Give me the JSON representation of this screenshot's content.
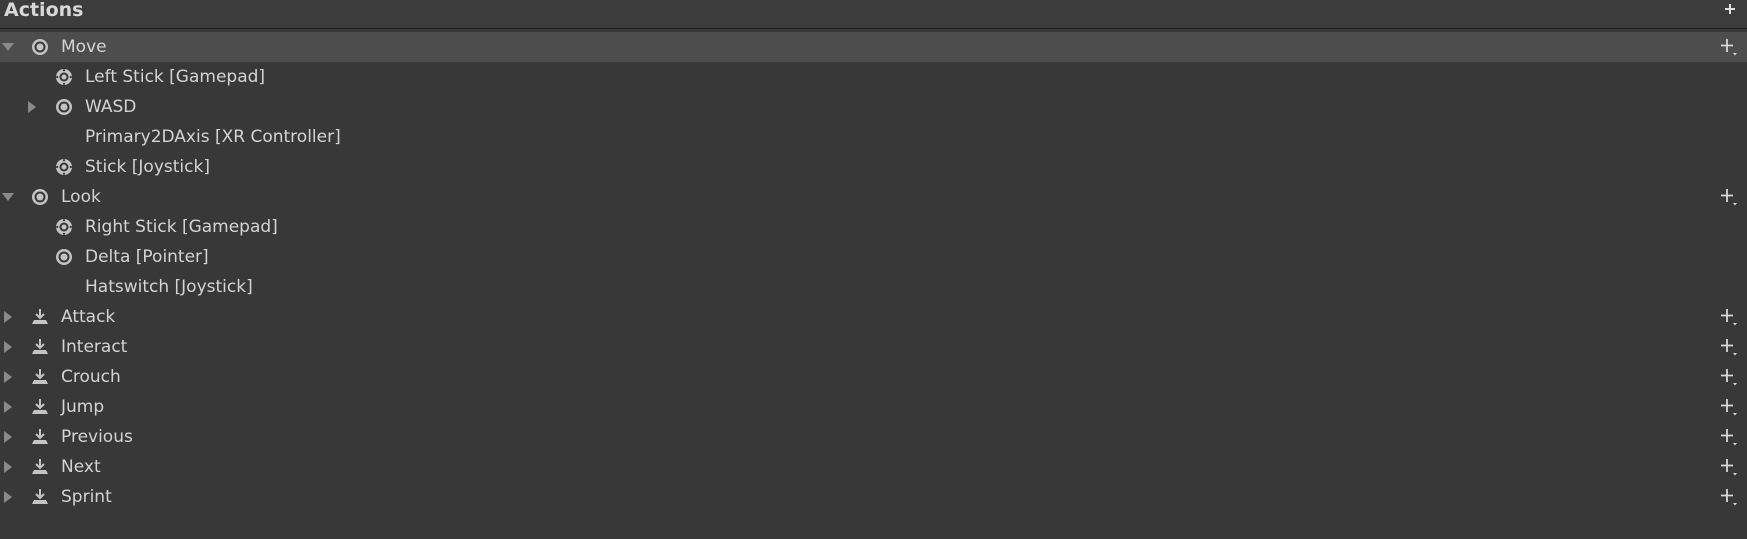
{
  "header": {
    "title": "Actions",
    "add_icon": "plus-icon"
  },
  "actions": [
    {
      "name": "Move",
      "expanded": true,
      "selected": true,
      "icon": "value-action-icon",
      "bindings": [
        {
          "label": "Left Stick [Gamepad]",
          "icon": "gamepad-stick-icon",
          "composite": false
        },
        {
          "label": "WASD",
          "icon": "composite-icon",
          "composite": true
        },
        {
          "label": "Primary2DAxis [XR Controller]",
          "icon": "",
          "composite": false
        },
        {
          "label": "Stick [Joystick]",
          "icon": "gamepad-stick-icon",
          "composite": false
        }
      ]
    },
    {
      "name": "Look",
      "expanded": true,
      "selected": false,
      "icon": "value-action-icon",
      "bindings": [
        {
          "label": "Right Stick [Gamepad]",
          "icon": "gamepad-stick-icon",
          "composite": false
        },
        {
          "label": "Delta [Pointer]",
          "icon": "pointer-delta-icon",
          "composite": false
        },
        {
          "label": "Hatswitch [Joystick]",
          "icon": "",
          "composite": false
        }
      ]
    },
    {
      "name": "Attack",
      "expanded": false,
      "selected": false,
      "icon": "button-action-icon",
      "bindings": []
    },
    {
      "name": "Interact",
      "expanded": false,
      "selected": false,
      "icon": "button-action-icon",
      "bindings": []
    },
    {
      "name": "Crouch",
      "expanded": false,
      "selected": false,
      "icon": "button-action-icon",
      "bindings": []
    },
    {
      "name": "Jump",
      "expanded": false,
      "selected": false,
      "icon": "button-action-icon",
      "bindings": []
    },
    {
      "name": "Previous",
      "expanded": false,
      "selected": false,
      "icon": "button-action-icon",
      "bindings": []
    },
    {
      "name": "Next",
      "expanded": false,
      "selected": false,
      "icon": "button-action-icon",
      "bindings": []
    },
    {
      "name": "Sprint",
      "expanded": false,
      "selected": false,
      "icon": "button-action-icon",
      "bindings": []
    }
  ],
  "colors": {
    "background": "#383838",
    "header": "#3c3c3c",
    "selected_row": "#4d4d4d",
    "text": "#d4d4d4",
    "icon": "#c4c4c4",
    "foldout": "#8a8a8a"
  }
}
